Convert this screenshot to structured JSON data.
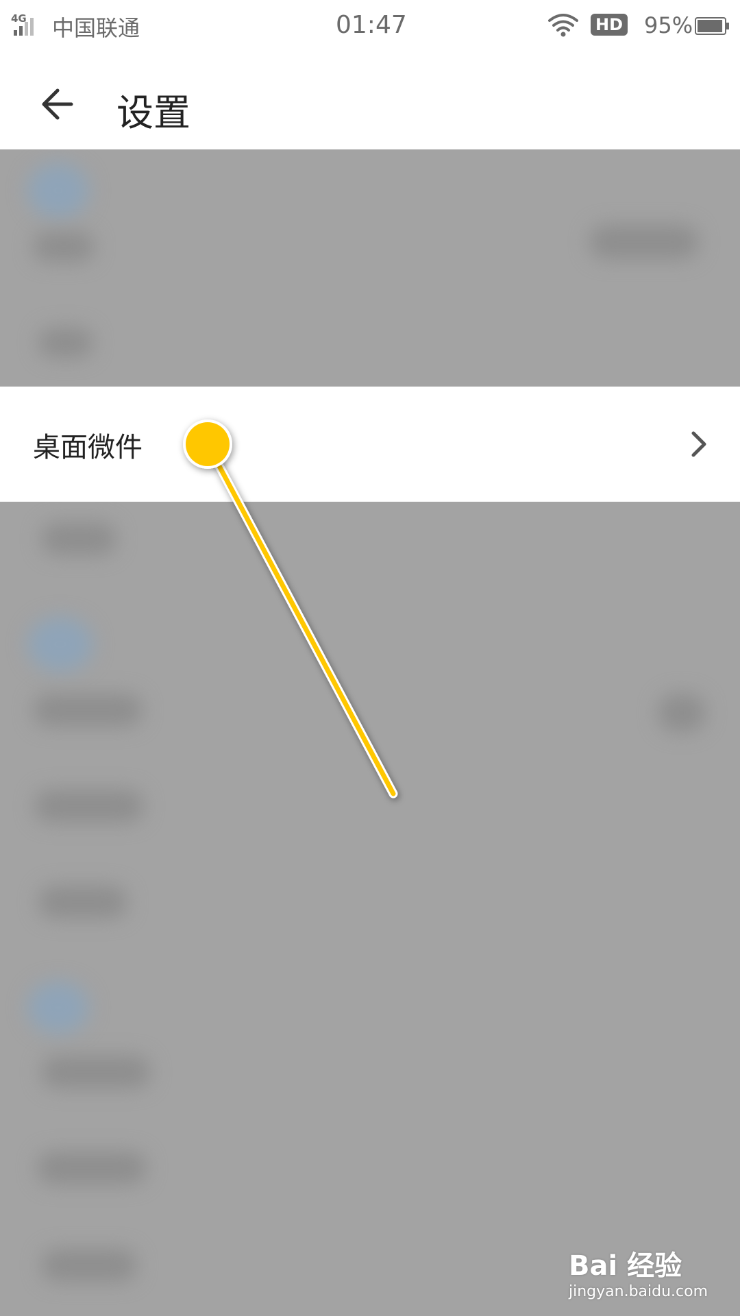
{
  "status_bar": {
    "network": "4G",
    "carrier": "中国联通",
    "time": "01:47",
    "hd_badge": "HD",
    "battery_percent": "95%",
    "battery_level": 0.95,
    "icons": [
      "signal-icon",
      "wifi-icon",
      "battery-icon"
    ]
  },
  "header": {
    "back_icon": "arrow-left-icon",
    "title": "设置"
  },
  "highlighted_item": {
    "label": "桌面微件",
    "chevron_icon": "chevron-right-icon"
  },
  "annotation": {
    "pointer_color": "#FFC700"
  },
  "watermark": {
    "logo_text": "Bai 经验",
    "url": "jingyan.baidu.com"
  },
  "colors": {
    "overlay_gray": "#A3A3A3",
    "text_dark": "#222222",
    "status_gray": "#6B6B6B"
  }
}
